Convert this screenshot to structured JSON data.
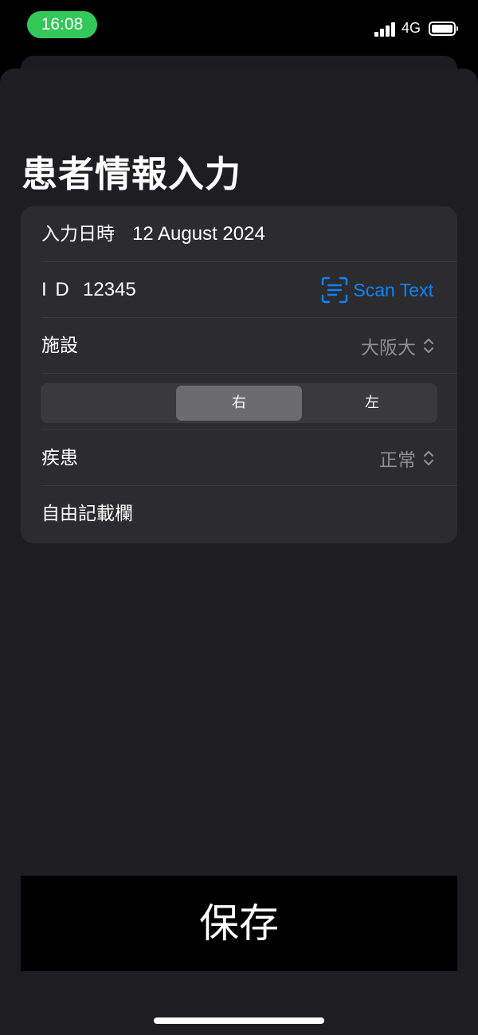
{
  "status_bar": {
    "time": "16:08",
    "network": "4G"
  },
  "page": {
    "title": "患者情報入力"
  },
  "form": {
    "date": {
      "label": "入力日時",
      "value": "12 August 2024"
    },
    "id": {
      "label": "I D",
      "value": "12345",
      "scan_label": "Scan Text"
    },
    "facility": {
      "label": "施設",
      "value": "大阪大"
    },
    "side": {
      "options": [
        "",
        "右",
        "左"
      ],
      "selected": "右"
    },
    "disease": {
      "label": "疾患",
      "value": "正常"
    },
    "notes": {
      "placeholder": "自由記載欄"
    }
  },
  "actions": {
    "save_label": "保存"
  },
  "colors": {
    "accent": "#0a84ff",
    "time_pill": "#34c759",
    "card": "#2c2c2e",
    "sheet": "#1e1e20"
  },
  "icons": [
    "signal-icon",
    "battery-icon",
    "scan-text-icon",
    "chevron-updown-icon"
  ]
}
